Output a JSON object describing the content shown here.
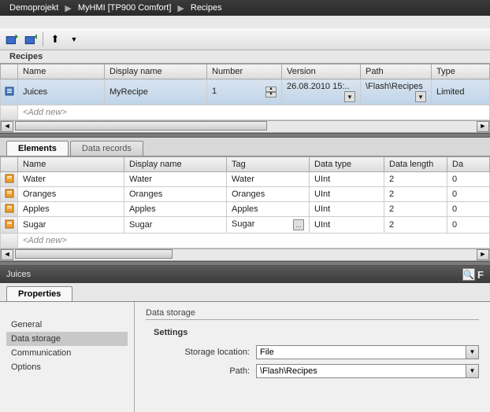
{
  "breadcrumb": {
    "a": "Demoprojekt",
    "b": "MyHMI [TP900 Comfort]",
    "c": "Recipes"
  },
  "recipes": {
    "title": "Recipes",
    "cols": {
      "name": "Name",
      "display": "Display name",
      "number": "Number",
      "version": "Version",
      "path": "Path",
      "type": "Type"
    },
    "row": {
      "name": "Juices",
      "display": "MyRecipe",
      "number": "1",
      "version": "26.08.2010 15:..",
      "path": "\\Flash\\Recipes",
      "type": "Limited"
    },
    "addnew": "<Add new>"
  },
  "tabs": {
    "elements": "Elements",
    "records": "Data records"
  },
  "elements": {
    "cols": {
      "name": "Name",
      "display": "Display name",
      "tag": "Tag",
      "dtype": "Data type",
      "dlen": "Data length",
      "da": "Da"
    },
    "rows": [
      {
        "name": "Water",
        "display": "Water",
        "tag": "Water",
        "dtype": "UInt",
        "dlen": "2",
        "da": "0"
      },
      {
        "name": "Oranges",
        "display": "Oranges",
        "tag": "Oranges",
        "dtype": "UInt",
        "dlen": "2",
        "da": "0"
      },
      {
        "name": "Apples",
        "display": "Apples",
        "tag": "Apples",
        "dtype": "UInt",
        "dlen": "2",
        "da": "0"
      },
      {
        "name": "Sugar",
        "display": "Sugar",
        "tag": "Sugar",
        "dtype": "UInt",
        "dlen": "2",
        "da": "0"
      }
    ],
    "addnew": "<Add new>"
  },
  "panel": {
    "title": "Juices",
    "searchLetter": "F",
    "tab": "Properties",
    "nav": {
      "general": "General",
      "storage": "Data storage",
      "comm": "Communication",
      "options": "Options"
    },
    "group": "Data storage",
    "settings": "Settings",
    "storLoc": {
      "label": "Storage location:",
      "value": "File"
    },
    "path": {
      "label": "Path:",
      "value": "\\Flash\\Recipes"
    }
  }
}
